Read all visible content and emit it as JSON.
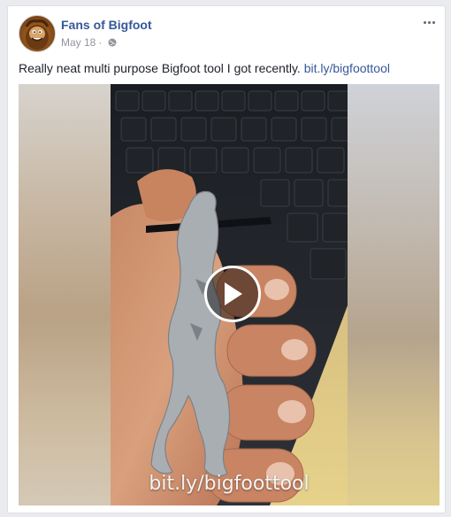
{
  "post": {
    "page_name": "Fans of Bigfoot",
    "date": "May 18",
    "dot": "·",
    "privacy_icon": "globe-icon",
    "more_icon": "more-options-icon",
    "text": "Really neat multi purpose Bigfoot tool I got recently. ",
    "link_text": "bit.ly/bigfoottool"
  },
  "video": {
    "caption": "bit.ly/bigfoottool",
    "play_icon": "play-icon"
  },
  "colors": {
    "link": "#365899",
    "text": "#1d2129",
    "meta": "#90949c"
  }
}
